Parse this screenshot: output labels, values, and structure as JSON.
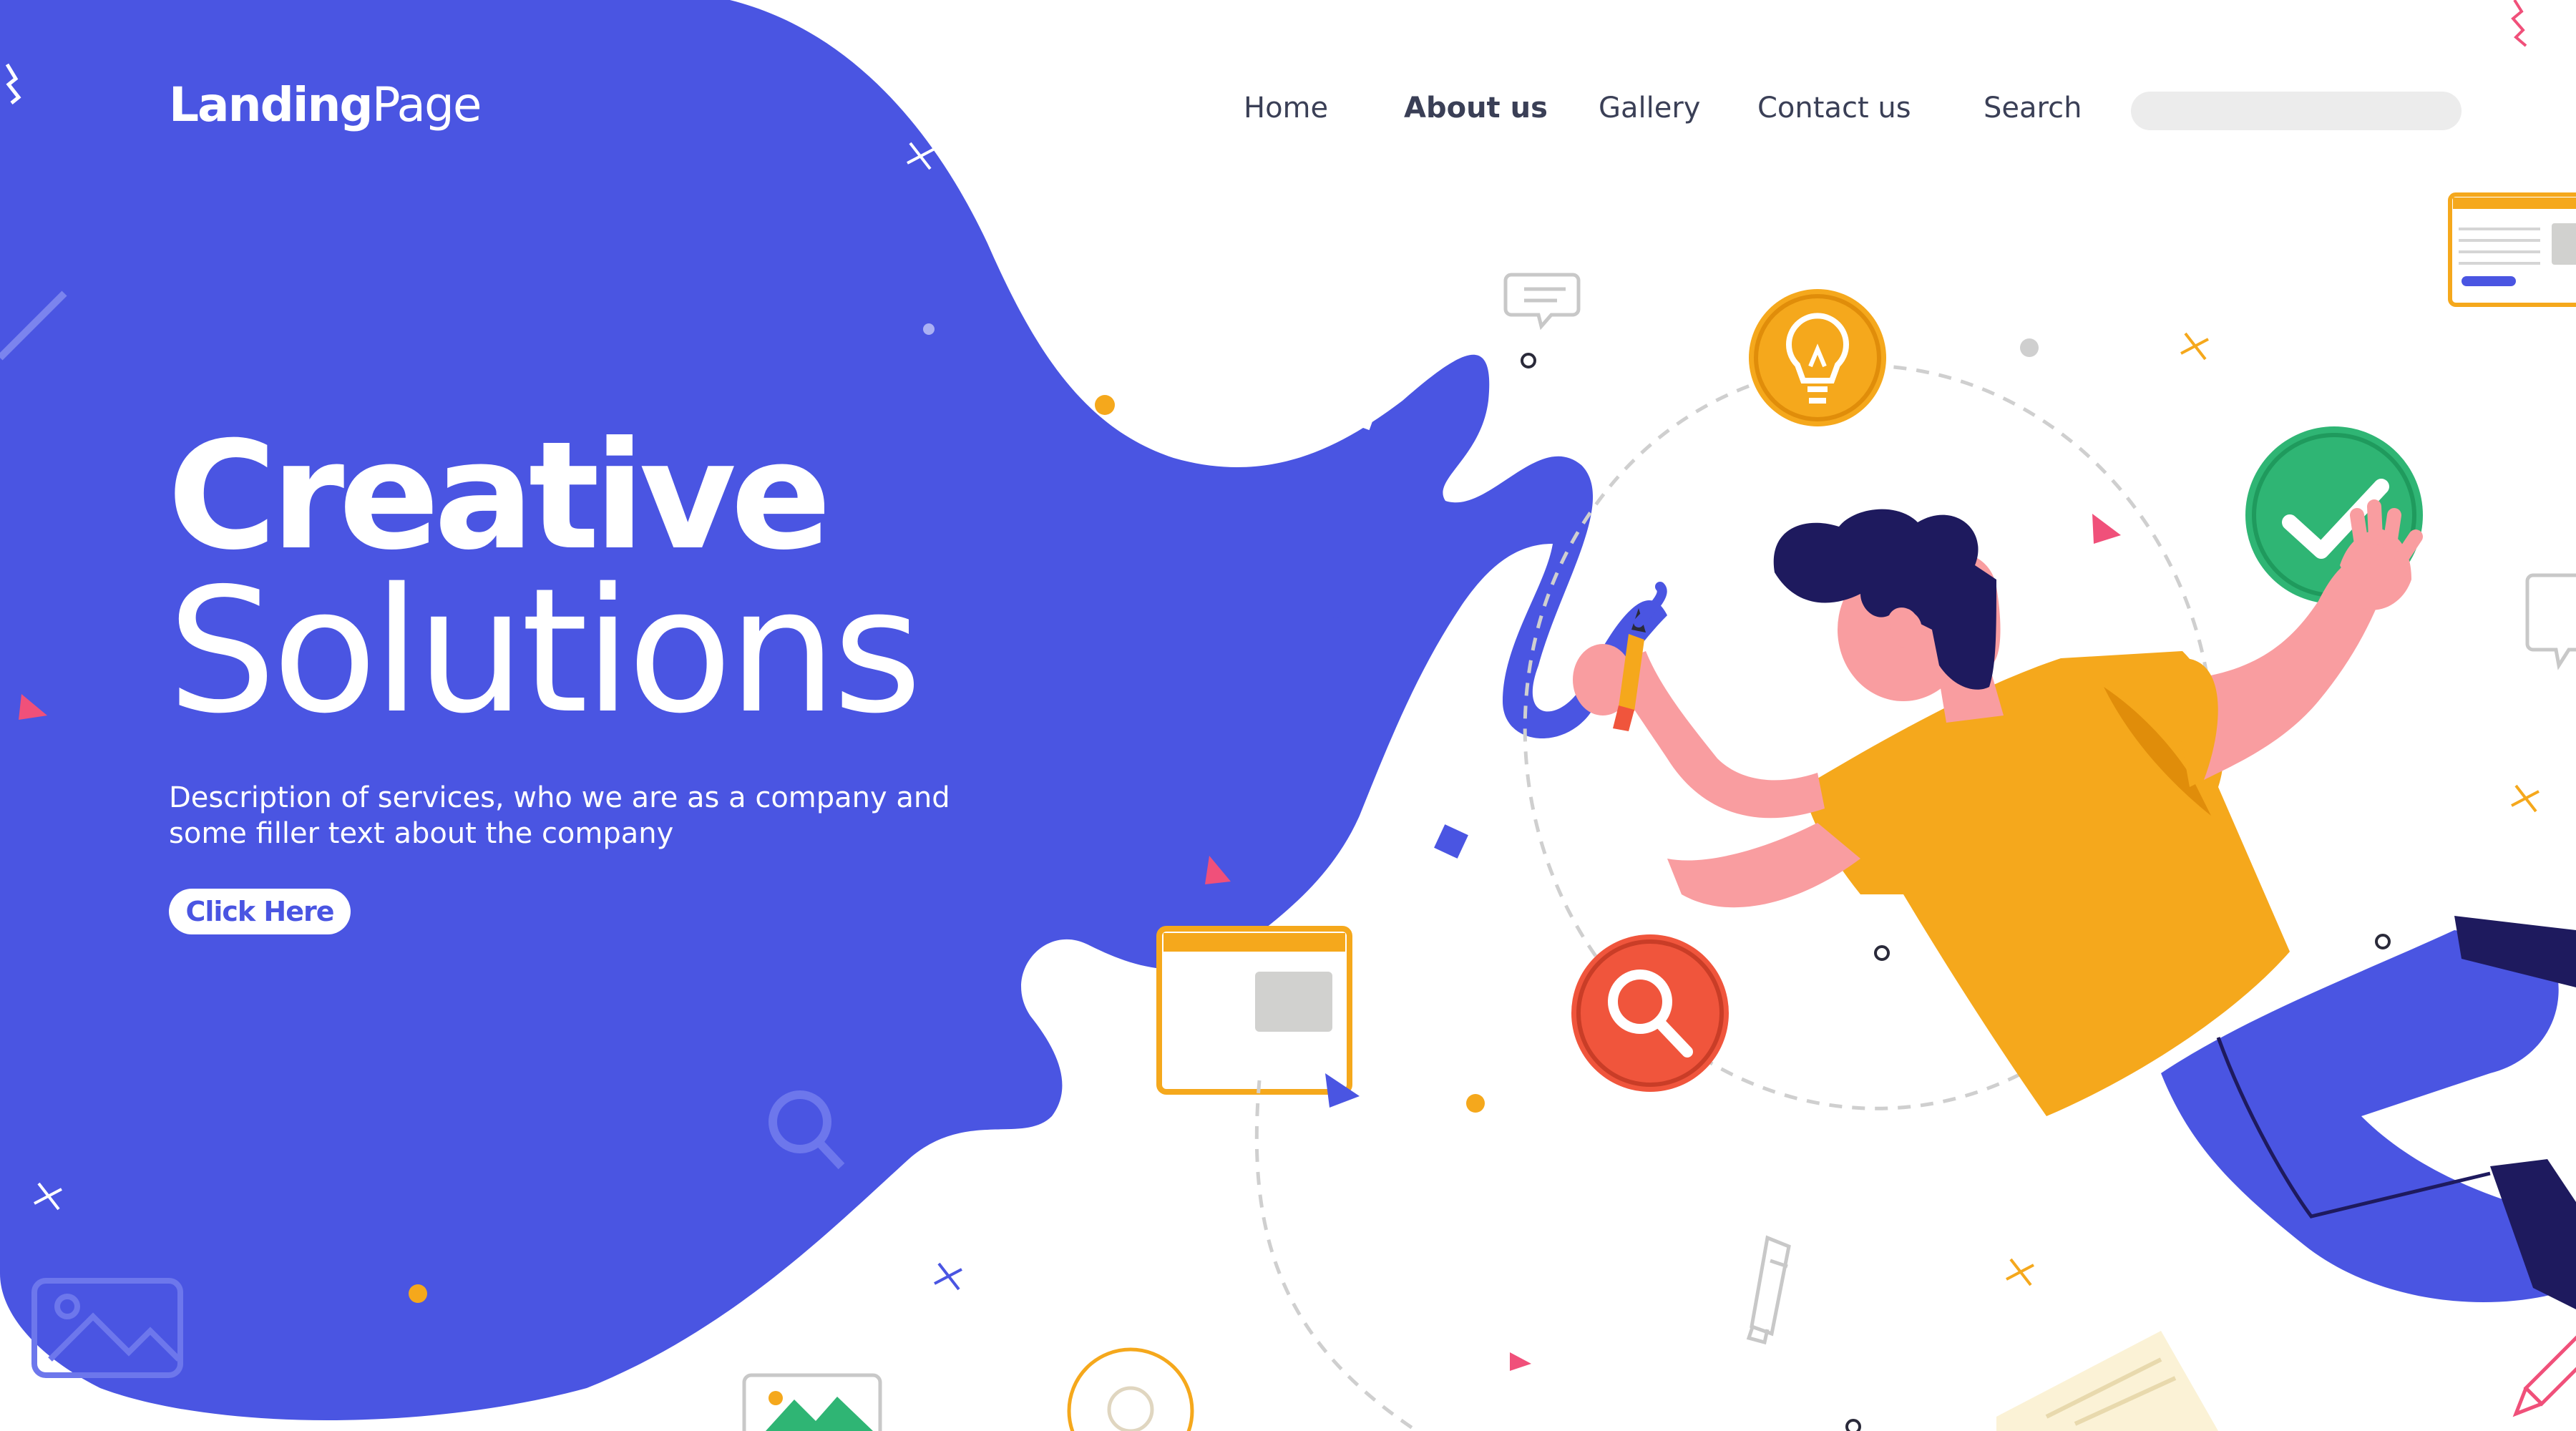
{
  "header": {
    "logo_bold": "Landing",
    "logo_light": "Page",
    "nav": [
      {
        "label": "Home",
        "active": false
      },
      {
        "label": "About us",
        "active": true
      },
      {
        "label": "Gallery",
        "active": false
      },
      {
        "label": "Contact us",
        "active": false
      },
      {
        "label": "Search",
        "active": false
      }
    ],
    "search": {
      "value": "",
      "placeholder": ""
    }
  },
  "hero": {
    "title_line1": "Creative",
    "title_line2": "Solutions",
    "description": "Description of services, who we are as a company and some filler text about the company",
    "cta_label": "Click Here"
  },
  "colors": {
    "brand_blue": "#4a55e2",
    "shirt_yellow": "#f5a81c",
    "check_green": "#2fb574",
    "search_red": "#f0553c",
    "bulb_orange": "#f5a81c",
    "hair_navy": "#1e1a5e",
    "skin_pink": "#f99da0"
  },
  "icons": [
    "lightbulb-icon",
    "check-icon",
    "magnifier-icon",
    "chat-bubble-icon",
    "browser-window-icon",
    "image-icon",
    "pencil-icon",
    "paintbrush-icon"
  ]
}
